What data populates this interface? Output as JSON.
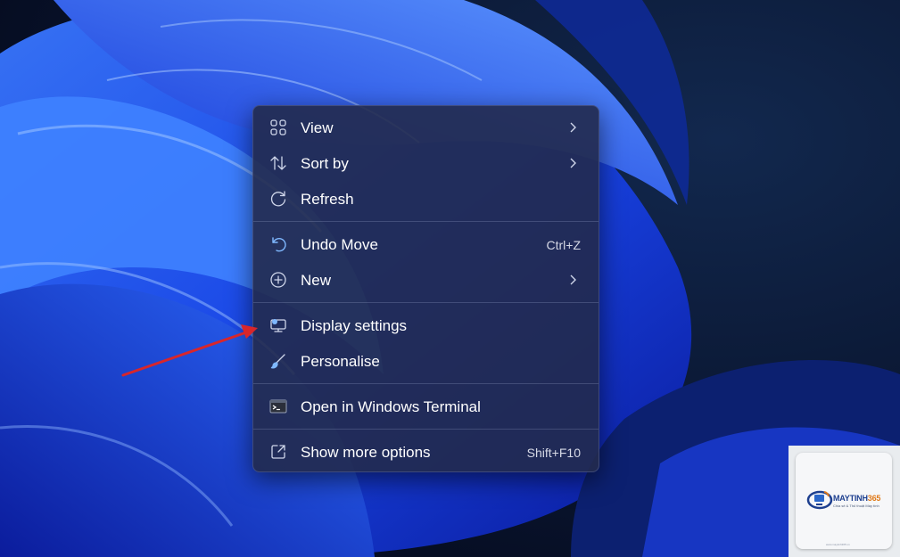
{
  "menu": {
    "items": [
      {
        "label": "View",
        "icon": "view-grid-icon",
        "submenu": true
      },
      {
        "label": "Sort by",
        "icon": "sort-icon",
        "submenu": true
      },
      {
        "label": "Refresh",
        "icon": "refresh-icon"
      },
      {
        "label": "Undo Move",
        "icon": "undo-icon",
        "shortcut": "Ctrl+Z"
      },
      {
        "label": "New",
        "icon": "new-plus-icon",
        "submenu": true
      },
      {
        "label": "Display settings",
        "icon": "display-settings-icon"
      },
      {
        "label": "Personalise",
        "icon": "brush-icon"
      },
      {
        "label": "Open in Windows Terminal",
        "icon": "terminal-icon"
      },
      {
        "label": "Show more options",
        "icon": "show-more-icon",
        "shortcut": "Shift+F10"
      }
    ]
  },
  "watermark": {
    "brand_main": "MAYTINH",
    "brand_accent": "365",
    "tagline": "Chia sẻ & Thủ thuật Máy tính",
    "url": "www.maytinh365.vn"
  },
  "colors": {
    "menu_bg": "#222a4c",
    "accent_icon": "#7fb8ff",
    "annotation_arrow": "#d8262b",
    "wallpaper_blue": "#1f4cff"
  }
}
